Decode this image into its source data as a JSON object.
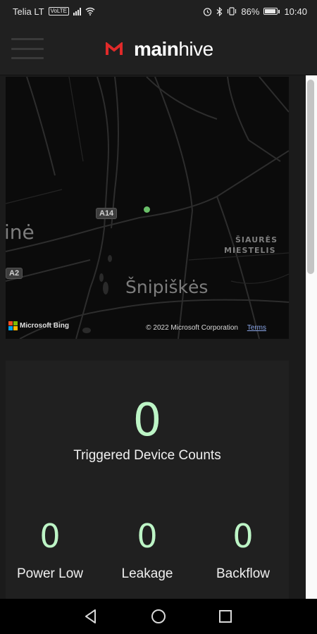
{
  "status_bar": {
    "carrier": "Telia LT",
    "volte": "VoLTE",
    "battery_percent": "86%",
    "battery_level": 0.86,
    "time": "10:40"
  },
  "header": {
    "brand_part1": "main",
    "brand_part2": "hive",
    "brand_color": "#e02a2a"
  },
  "map": {
    "labels": {
      "district_partial": "inė",
      "district_main": "Šnipiškės",
      "district_ne_line1": "ŠIAURĖS",
      "district_ne_line2": "MIESTELIS"
    },
    "road_shields": [
      "A14",
      "A2"
    ],
    "attribution": "Microsoft Bing",
    "copyright": "© 2022 Microsoft Corporation",
    "terms_link": "Terms",
    "marker_color": "#6abf69"
  },
  "stats": {
    "triggered_count": "0",
    "triggered_label": "Triggered Device Counts",
    "items": [
      {
        "value": "0",
        "label": "Power Low"
      },
      {
        "value": "0",
        "label": "Leakage"
      },
      {
        "value": "0",
        "label": "Backflow"
      }
    ],
    "accent_color": "#bdf5c6"
  },
  "nav": {
    "back": "back-icon",
    "home": "home-icon",
    "recents": "recents-icon"
  }
}
